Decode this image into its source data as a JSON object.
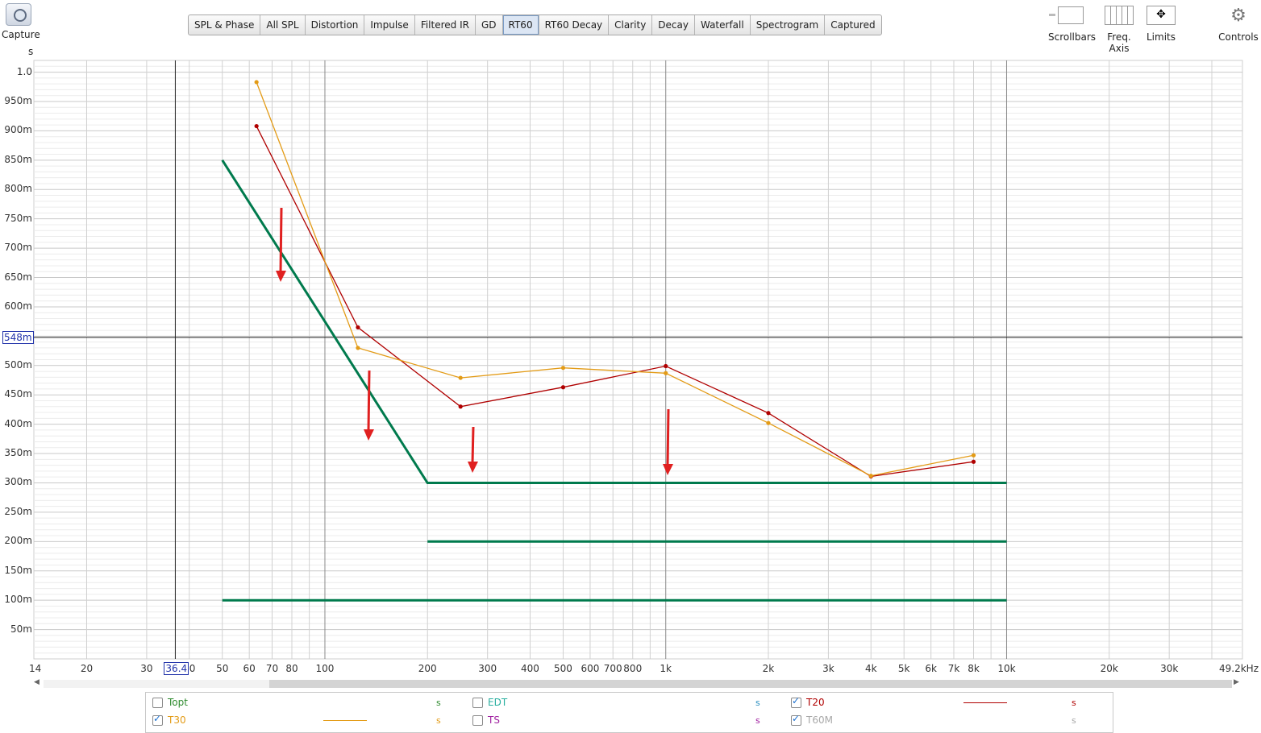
{
  "toolbar": {
    "capture_label": "Capture",
    "tabs": [
      "SPL & Phase",
      "All SPL",
      "Distortion",
      "Impulse",
      "Filtered IR",
      "GD",
      "RT60",
      "RT60 Decay",
      "Clarity",
      "Decay",
      "Waterfall",
      "Spectrogram",
      "Captured"
    ],
    "active_tab": "RT60",
    "right": {
      "scrollbars_label": "Scrollbars",
      "freq_axis_label": "Freq. Axis",
      "limits_label": "Limits",
      "controls_label": "Controls"
    }
  },
  "graph": {
    "y_unit": "s",
    "y_ticks": [
      "1.0",
      "950m",
      "900m",
      "850m",
      "800m",
      "750m",
      "700m",
      "650m",
      "600m",
      "550m",
      "500m",
      "450m",
      "400m",
      "350m",
      "300m",
      "250m",
      "200m",
      "150m",
      "100m",
      "50m"
    ],
    "x_ticks": [
      "14",
      "20",
      "30",
      "40",
      "50",
      "60",
      "70",
      "80",
      "100",
      "200",
      "300",
      "400",
      "500",
      "600",
      "700",
      "800",
      "1k",
      "2k",
      "3k",
      "4k",
      "5k",
      "6k",
      "7k",
      "8k",
      "10k",
      "20k",
      "30k",
      "49.2kHz"
    ],
    "cursor_y_label": "548m",
    "cursor_x_label": "36.4"
  },
  "chart_data": {
    "type": "line",
    "x_scale": "log",
    "xlabel": "",
    "ylabel": "s",
    "xlim": [
      14,
      49200
    ],
    "ylim": [
      0,
      1.02
    ],
    "series": [
      {
        "name": "T20",
        "color": "#b00000",
        "points": [
          [
            63,
            0.908
          ],
          [
            125,
            0.565
          ],
          [
            250,
            0.43
          ],
          [
            500,
            0.463
          ],
          [
            1000,
            0.499
          ],
          [
            2000,
            0.419
          ],
          [
            4000,
            0.311
          ],
          [
            8000,
            0.336
          ]
        ]
      },
      {
        "name": "T30",
        "color": "#e39b16",
        "points": [
          [
            63,
            0.983
          ],
          [
            125,
            0.53
          ],
          [
            250,
            0.479
          ],
          [
            500,
            0.496
          ],
          [
            1000,
            0.487
          ],
          [
            2000,
            0.402
          ],
          [
            4000,
            0.312
          ],
          [
            8000,
            0.347
          ]
        ]
      },
      {
        "color": "#007a4d",
        "points": [
          [
            50,
            0.85
          ],
          [
            200,
            0.3
          ],
          [
            10000,
            0.3
          ]
        ]
      },
      {
        "color": "#007a4d",
        "points": [
          [
            200,
            0.2
          ],
          [
            10000,
            0.2
          ]
        ]
      },
      {
        "color": "#007a4d",
        "points": [
          [
            50,
            0.1
          ],
          [
            10000,
            0.1
          ]
        ]
      }
    ],
    "cursor": {
      "x": 36.4,
      "y": 0.548
    }
  },
  "legend": {
    "items": [
      {
        "label": "Topt",
        "checked": false,
        "color": "#2e8b2e",
        "unit": "s",
        "unit_color": "#2e8b2e"
      },
      {
        "label": "EDT",
        "checked": false,
        "color": "#2ab0a0",
        "unit": "s",
        "unit_color": "#2a8fc0"
      },
      {
        "label": "T20",
        "checked": true,
        "color": "#b00000",
        "unit": "s",
        "unit_color": "#b00000"
      },
      {
        "label": "T30",
        "checked": true,
        "color": "#e39b16",
        "unit": "s",
        "unit_color": "#e39b16"
      },
      {
        "label": "TS",
        "checked": false,
        "color": "#a020a0",
        "unit": "s",
        "unit_color": "#a020a0"
      },
      {
        "label": "T60M",
        "checked": true,
        "color": "#a8a8a8",
        "unit": "s",
        "unit_color": "#a8a8a8"
      }
    ]
  }
}
